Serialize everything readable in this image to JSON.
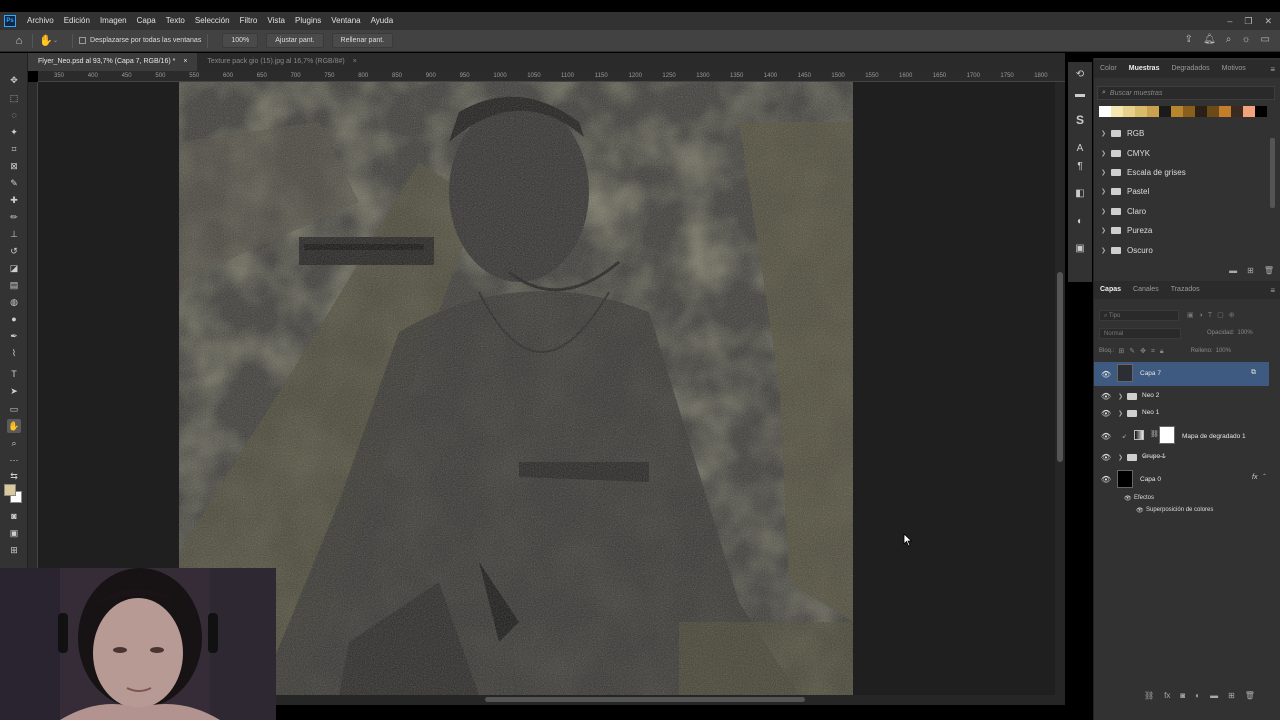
{
  "menu": {
    "logo": "Ps",
    "items": [
      "Archivo",
      "Edición",
      "Imagen",
      "Capa",
      "Texto",
      "Selección",
      "Filtro",
      "Vista",
      "Plugins",
      "Ventana",
      "Ayuda"
    ]
  },
  "options": {
    "scroll_all_label": "Desplazarse por todas las ventanas",
    "zoom_button": "100%",
    "fit_button": "Ajustar pant.",
    "fill_button": "Rellenar pant."
  },
  "tabs": [
    {
      "label": "Flyer_Neo.psd al 93,7% (Capa 7, RGB/16) *",
      "active": true
    },
    {
      "label": "Texture pack gio (15).jpg al 16,7% (RGB/8#)",
      "active": false
    }
  ],
  "ruler_ticks": [
    "350",
    "400",
    "450",
    "500",
    "550",
    "600",
    "650",
    "700",
    "750",
    "800",
    "850",
    "900",
    "950",
    "1000",
    "1050",
    "1100",
    "1150",
    "1200",
    "1250",
    "1300",
    "1350",
    "1400",
    "1450",
    "1500",
    "1550",
    "1600",
    "1650",
    "1700",
    "1750",
    "1800",
    "1850"
  ],
  "swatches_panel": {
    "tabs": [
      "Color",
      "Muestras",
      "Degradados",
      "Motivos"
    ],
    "active_tab": "Muestras",
    "search_placeholder": "Buscar muestras",
    "swatch_colors": [
      "#ffffff",
      "#f5e7b0",
      "#e8d18a",
      "#d9bb6c",
      "#c8a24e",
      "#1a1a1a",
      "#b8862c",
      "#8a5f1c",
      "#2a2018",
      "#6b4a18",
      "#c47e2a",
      "#3a2a20",
      "#f2a37e",
      "#000000"
    ],
    "groups": [
      "RGB",
      "CMYK",
      "Escala de grises",
      "Pastel",
      "Claro",
      "Pureza",
      "Oscuro"
    ]
  },
  "layers_panel": {
    "tabs": [
      "Capas",
      "Canales",
      "Trazados"
    ],
    "active_tab": "Capas",
    "filter_label": "Tipo",
    "blend_mode": "Normal",
    "opacity_label": "Opacidad:",
    "opacity_value": "100%",
    "lock_label": "Bloq.:",
    "fill_label": "Relleno:",
    "fill_value": "100%",
    "layers": [
      {
        "name": "Capa 7",
        "selected": true
      },
      {
        "name": "Neo 2",
        "selected": false
      },
      {
        "name": "Neo 1",
        "selected": false
      },
      {
        "name": "Mapa de degradado 1",
        "selected": false
      },
      {
        "name": "Grupo 1",
        "selected": false
      },
      {
        "name": "Capa 0",
        "selected": false
      }
    ],
    "effects_label": "Efectos",
    "effect_item": "Superposición de colores",
    "fx_label": "fx"
  }
}
